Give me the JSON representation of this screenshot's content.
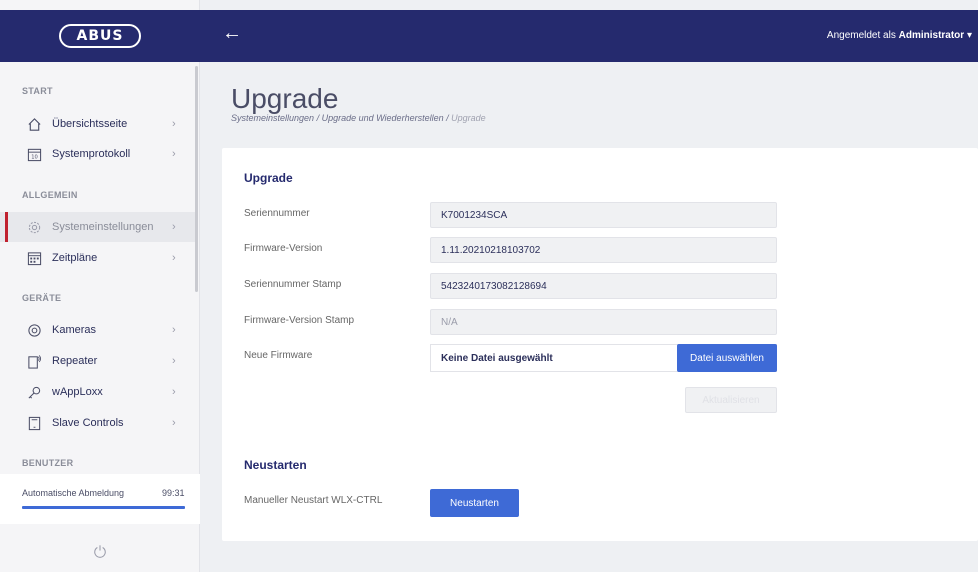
{
  "brand": {
    "logo_text": "ABUS"
  },
  "topbar": {
    "back_icon": "arrow-left-icon",
    "login_prefix": "Angemeldet als",
    "login_user": "Administrator"
  },
  "sidebar": {
    "sections": {
      "start": "START",
      "allgemein": "ALLGEMEIN",
      "geraete": "GERÄTE",
      "benutzer": "BENUTZER"
    },
    "items": [
      {
        "label": "Übersichtsseite",
        "icon": "home-icon"
      },
      {
        "label": "Systemprotokoll",
        "icon": "calendar-icon"
      },
      {
        "label": "Systemeinstellungen",
        "icon": "gear-icon"
      },
      {
        "label": "Zeitpläne",
        "icon": "schedule-icon"
      },
      {
        "label": "Kameras",
        "icon": "camera-icon"
      },
      {
        "label": "Repeater",
        "icon": "repeater-icon"
      },
      {
        "label": "wAppLoxx",
        "icon": "key-icon"
      },
      {
        "label": "Slave Controls",
        "icon": "tablet-icon"
      }
    ],
    "auto_logout": {
      "label": "Automatische Abmeldung",
      "value": "99:31",
      "progress": 1.0
    }
  },
  "page": {
    "title": "Upgrade",
    "breadcrumb": [
      "Systemeinstellungen",
      "Upgrade und Wiederherstellen",
      "Upgrade"
    ]
  },
  "upgrade": {
    "heading": "Upgrade",
    "rows": [
      {
        "label": "Seriennummer",
        "value": "K7001234SCA"
      },
      {
        "label": "Firmware-Version",
        "value": "1.11.20210218103702"
      },
      {
        "label": "Seriennummer Stamp",
        "value": "5423240173082128694"
      },
      {
        "label": "Firmware-Version Stamp",
        "value": "N/A"
      }
    ],
    "new_firmware_label": "Neue Firmware",
    "file_status": "Keine Datei ausgewählt",
    "file_button": "Datei auswählen",
    "update_button": "Aktualisieren"
  },
  "restart": {
    "heading": "Neustarten",
    "label": "Manueller Neustart WLX-CTRL",
    "button": "Neustarten"
  },
  "colors": {
    "navy": "#252a6e",
    "accent": "#3e6ad6",
    "active_marker": "#c0212f"
  }
}
